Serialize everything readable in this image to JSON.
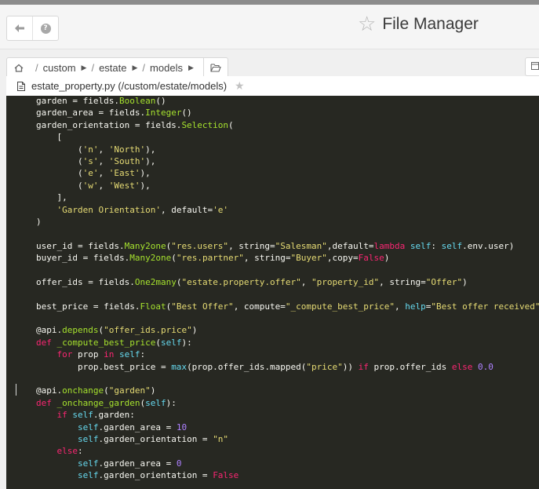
{
  "app": {
    "title": "File Manager"
  },
  "header": {
    "back_icon": "arrow-left-icon",
    "help_icon": "question-circle-icon",
    "favorite_icon": "star-outline-icon"
  },
  "breadcrumb": {
    "home_icon": "home-icon",
    "items": [
      "custom",
      "estate",
      "models"
    ],
    "folder_icon": "folder-open-icon"
  },
  "file_tab": {
    "label": "estate_property.py (/custom/estate/models)",
    "file_icon": "file-icon",
    "star_icon": "star-icon"
  },
  "colors": {
    "editor_bg": "#272822",
    "keyword": "#f92672",
    "function": "#a6e22e",
    "string": "#e6db74",
    "self": "#66d9ef",
    "number": "#ae81ff",
    "plain": "#f8f8f2"
  },
  "code_lines": [
    [
      {
        "t": "garden = fields.",
        "c": "pl"
      },
      {
        "t": "Boolean",
        "c": "fn"
      },
      {
        "t": "()",
        "c": "pl"
      }
    ],
    [
      {
        "t": "garden_area = fields.",
        "c": "pl"
      },
      {
        "t": "Integer",
        "c": "fn"
      },
      {
        "t": "()",
        "c": "pl"
      }
    ],
    [
      {
        "t": "garden_orientation = fields.",
        "c": "pl"
      },
      {
        "t": "Selection",
        "c": "fn"
      },
      {
        "t": "(",
        "c": "pl"
      }
    ],
    [
      {
        "t": "    [",
        "c": "pl"
      }
    ],
    [
      {
        "t": "        (",
        "c": "pl"
      },
      {
        "t": "'n'",
        "c": "st"
      },
      {
        "t": ", ",
        "c": "pl"
      },
      {
        "t": "'North'",
        "c": "st"
      },
      {
        "t": "),",
        "c": "pl"
      }
    ],
    [
      {
        "t": "        (",
        "c": "pl"
      },
      {
        "t": "'s'",
        "c": "st"
      },
      {
        "t": ", ",
        "c": "pl"
      },
      {
        "t": "'South'",
        "c": "st"
      },
      {
        "t": "),",
        "c": "pl"
      }
    ],
    [
      {
        "t": "        (",
        "c": "pl"
      },
      {
        "t": "'e'",
        "c": "st"
      },
      {
        "t": ", ",
        "c": "pl"
      },
      {
        "t": "'East'",
        "c": "st"
      },
      {
        "t": "),",
        "c": "pl"
      }
    ],
    [
      {
        "t": "        (",
        "c": "pl"
      },
      {
        "t": "'w'",
        "c": "st"
      },
      {
        "t": ", ",
        "c": "pl"
      },
      {
        "t": "'West'",
        "c": "st"
      },
      {
        "t": "),",
        "c": "pl"
      }
    ],
    [
      {
        "t": "    ],",
        "c": "pl"
      }
    ],
    [
      {
        "t": "    ",
        "c": "pl"
      },
      {
        "t": "'Garden Orientation'",
        "c": "st"
      },
      {
        "t": ", default=",
        "c": "pl"
      },
      {
        "t": "'e'",
        "c": "st"
      }
    ],
    [
      {
        "t": ")",
        "c": "pl"
      }
    ],
    [],
    [
      {
        "t": "user_id = fields.",
        "c": "pl"
      },
      {
        "t": "Many2one",
        "c": "fn"
      },
      {
        "t": "(",
        "c": "pl"
      },
      {
        "t": "\"res.users\"",
        "c": "st"
      },
      {
        "t": ", string=",
        "c": "pl"
      },
      {
        "t": "\"Salesman\"",
        "c": "st"
      },
      {
        "t": ",default=",
        "c": "pl"
      },
      {
        "t": "lambda",
        "c": "kw"
      },
      {
        "t": " ",
        "c": "pl"
      },
      {
        "t": "self",
        "c": "sf"
      },
      {
        "t": ": ",
        "c": "pl"
      },
      {
        "t": "self",
        "c": "sf"
      },
      {
        "t": ".env.user)",
        "c": "pl"
      }
    ],
    [
      {
        "t": "buyer_id = fields.",
        "c": "pl"
      },
      {
        "t": "Many2one",
        "c": "fn"
      },
      {
        "t": "(",
        "c": "pl"
      },
      {
        "t": "\"res.partner\"",
        "c": "st"
      },
      {
        "t": ", string=",
        "c": "pl"
      },
      {
        "t": "\"Buyer\"",
        "c": "st"
      },
      {
        "t": ",copy=",
        "c": "pl"
      },
      {
        "t": "False",
        "c": "kw"
      },
      {
        "t": ")",
        "c": "pl"
      }
    ],
    [],
    [
      {
        "t": "offer_ids = fields.",
        "c": "pl"
      },
      {
        "t": "One2many",
        "c": "fn"
      },
      {
        "t": "(",
        "c": "pl"
      },
      {
        "t": "\"estate.property.offer\"",
        "c": "st"
      },
      {
        "t": ", ",
        "c": "pl"
      },
      {
        "t": "\"property_id\"",
        "c": "st"
      },
      {
        "t": ", string=",
        "c": "pl"
      },
      {
        "t": "\"Offer\"",
        "c": "st"
      },
      {
        "t": ")",
        "c": "pl"
      }
    ],
    [],
    [
      {
        "t": "best_price = fields.",
        "c": "pl"
      },
      {
        "t": "Float",
        "c": "fn"
      },
      {
        "t": "(",
        "c": "pl"
      },
      {
        "t": "\"Best Offer\"",
        "c": "st"
      },
      {
        "t": ", compute=",
        "c": "pl"
      },
      {
        "t": "\"_compute_best_price\"",
        "c": "st"
      },
      {
        "t": ", ",
        "c": "pl"
      },
      {
        "t": "help",
        "c": "sf"
      },
      {
        "t": "=",
        "c": "pl"
      },
      {
        "t": "\"Best offer received\"",
        "c": "st"
      },
      {
        "t": ")",
        "c": "pl"
      }
    ],
    [],
    [
      {
        "t": "@api.",
        "c": "pl"
      },
      {
        "t": "depends",
        "c": "fn"
      },
      {
        "t": "(",
        "c": "pl"
      },
      {
        "t": "\"offer_ids.price\"",
        "c": "st"
      },
      {
        "t": ")",
        "c": "pl"
      }
    ],
    [
      {
        "t": "def",
        "c": "kw"
      },
      {
        "t": " ",
        "c": "pl"
      },
      {
        "t": "_compute_best_price",
        "c": "fn"
      },
      {
        "t": "(",
        "c": "pl"
      },
      {
        "t": "self",
        "c": "sf"
      },
      {
        "t": "):",
        "c": "pl"
      }
    ],
    [
      {
        "t": "    ",
        "c": "pl"
      },
      {
        "t": "for",
        "c": "kw"
      },
      {
        "t": " prop ",
        "c": "pl"
      },
      {
        "t": "in",
        "c": "kw"
      },
      {
        "t": " ",
        "c": "pl"
      },
      {
        "t": "self",
        "c": "sf"
      },
      {
        "t": ":",
        "c": "pl"
      }
    ],
    [
      {
        "t": "        prop.best_price = ",
        "c": "pl"
      },
      {
        "t": "max",
        "c": "sf"
      },
      {
        "t": "(prop.offer_ids.mapped(",
        "c": "pl"
      },
      {
        "t": "\"price\"",
        "c": "st"
      },
      {
        "t": ")) ",
        "c": "pl"
      },
      {
        "t": "if",
        "c": "kw"
      },
      {
        "t": " prop.offer_ids ",
        "c": "pl"
      },
      {
        "t": "else",
        "c": "kw"
      },
      {
        "t": " ",
        "c": "pl"
      },
      {
        "t": "0.0",
        "c": "nu"
      }
    ],
    [],
    [
      {
        "t": "@api.",
        "c": "pl"
      },
      {
        "t": "onchange",
        "c": "fn"
      },
      {
        "t": "(",
        "c": "pl"
      },
      {
        "t": "\"garden\"",
        "c": "st"
      },
      {
        "t": ")",
        "c": "pl"
      }
    ],
    [
      {
        "t": "def",
        "c": "kw"
      },
      {
        "t": " ",
        "c": "pl"
      },
      {
        "t": "_onchange_garden",
        "c": "fn"
      },
      {
        "t": "(",
        "c": "pl"
      },
      {
        "t": "self",
        "c": "sf"
      },
      {
        "t": "):",
        "c": "pl"
      }
    ],
    [
      {
        "t": "    ",
        "c": "pl"
      },
      {
        "t": "if",
        "c": "kw"
      },
      {
        "t": " ",
        "c": "pl"
      },
      {
        "t": "self",
        "c": "sf"
      },
      {
        "t": ".garden:",
        "c": "pl"
      }
    ],
    [
      {
        "t": "        ",
        "c": "pl"
      },
      {
        "t": "self",
        "c": "sf"
      },
      {
        "t": ".garden_area = ",
        "c": "pl"
      },
      {
        "t": "10",
        "c": "nu"
      }
    ],
    [
      {
        "t": "        ",
        "c": "pl"
      },
      {
        "t": "self",
        "c": "sf"
      },
      {
        "t": ".garden_orientation = ",
        "c": "pl"
      },
      {
        "t": "\"n\"",
        "c": "st"
      }
    ],
    [
      {
        "t": "    ",
        "c": "pl"
      },
      {
        "t": "else",
        "c": "kw"
      },
      {
        "t": ":",
        "c": "pl"
      }
    ],
    [
      {
        "t": "        ",
        "c": "pl"
      },
      {
        "t": "self",
        "c": "sf"
      },
      {
        "t": ".garden_area = ",
        "c": "pl"
      },
      {
        "t": "0",
        "c": "nu"
      }
    ],
    [
      {
        "t": "        ",
        "c": "pl"
      },
      {
        "t": "self",
        "c": "sf"
      },
      {
        "t": ".garden_orientation = ",
        "c": "pl"
      },
      {
        "t": "False",
        "c": "kw"
      }
    ]
  ]
}
